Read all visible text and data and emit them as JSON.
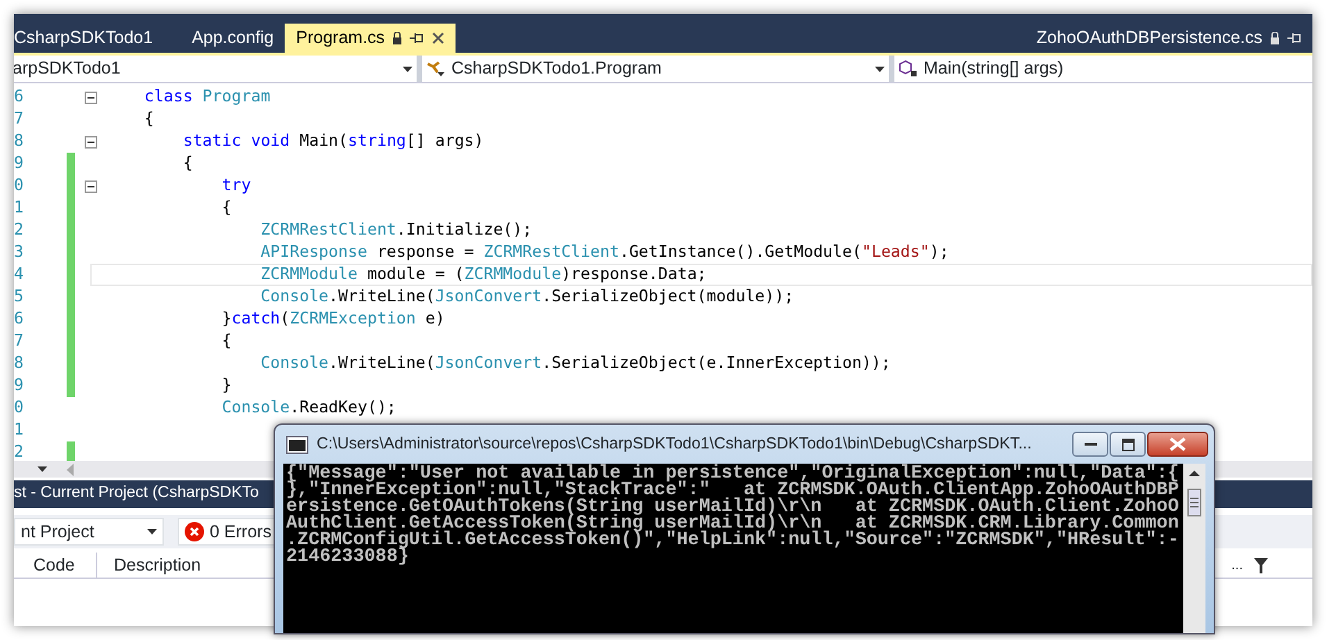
{
  "tabs": [
    {
      "label": "CsharpSDKTodo1",
      "selected": false
    },
    {
      "label": "App.config",
      "selected": false
    },
    {
      "label": "Program.cs",
      "selected": true
    },
    {
      "label": "ZohoOAuthDBPersistence.cs",
      "selected": false
    }
  ],
  "navigation_bar": {
    "project": "arpSDKTodo1",
    "class": "CsharpSDKTodo1.Program",
    "member": "Main(string[] args)"
  },
  "code_lines": [
    {
      "number": "6",
      "fold": true,
      "changed": false,
      "current": false,
      "tokens": [
        {
          "kind": "keyword",
          "text": "    class"
        },
        {
          "kind": "type",
          "text": " Program"
        }
      ]
    },
    {
      "number": "7",
      "fold": false,
      "changed": false,
      "current": false,
      "tokens": [
        {
          "kind": "plain",
          "text": "    {"
        }
      ]
    },
    {
      "number": "8",
      "fold": true,
      "changed": false,
      "current": false,
      "tokens": [
        {
          "kind": "keyword",
          "text": "        static"
        },
        {
          "kind": "keyword",
          "text": " void"
        },
        {
          "kind": "plain",
          "text": " Main("
        },
        {
          "kind": "keyword",
          "text": "string"
        },
        {
          "kind": "plain",
          "text": "[] args)"
        }
      ]
    },
    {
      "number": "9",
      "fold": false,
      "changed": true,
      "current": false,
      "tokens": [
        {
          "kind": "plain",
          "text": "        {"
        }
      ]
    },
    {
      "number": "0",
      "fold": true,
      "changed": true,
      "current": false,
      "tokens": [
        {
          "kind": "keyword",
          "text": "            try"
        }
      ]
    },
    {
      "number": "1",
      "fold": false,
      "changed": true,
      "current": false,
      "tokens": [
        {
          "kind": "plain",
          "text": "            {"
        }
      ]
    },
    {
      "number": "2",
      "fold": false,
      "changed": true,
      "current": false,
      "tokens": [
        {
          "kind": "type",
          "text": "                ZCRMRestClient"
        },
        {
          "kind": "plain",
          "text": ".Initialize();"
        }
      ]
    },
    {
      "number": "3",
      "fold": false,
      "changed": true,
      "current": false,
      "tokens": [
        {
          "kind": "type",
          "text": "                APIResponse"
        },
        {
          "kind": "plain",
          "text": " response = "
        },
        {
          "kind": "type",
          "text": "ZCRMRestClient"
        },
        {
          "kind": "plain",
          "text": ".GetInstance().GetModule("
        },
        {
          "kind": "string",
          "text": "\"Leads\""
        },
        {
          "kind": "plain",
          "text": ");"
        }
      ]
    },
    {
      "number": "4",
      "fold": false,
      "changed": true,
      "current": true,
      "tokens": [
        {
          "kind": "type",
          "text": "                ZCRMModule"
        },
        {
          "kind": "plain",
          "text": " module = ("
        },
        {
          "kind": "type",
          "text": "ZCRMModule"
        },
        {
          "kind": "plain",
          "text": ")response.Data;"
        }
      ]
    },
    {
      "number": "5",
      "fold": false,
      "changed": true,
      "current": false,
      "tokens": [
        {
          "kind": "type",
          "text": "                Console"
        },
        {
          "kind": "plain",
          "text": ".WriteLine("
        },
        {
          "kind": "type",
          "text": "JsonConvert"
        },
        {
          "kind": "plain",
          "text": ".SerializeObject(module));"
        }
      ]
    },
    {
      "number": "6",
      "fold": false,
      "changed": true,
      "current": false,
      "tokens": [
        {
          "kind": "plain",
          "text": "            }"
        },
        {
          "kind": "keyword",
          "text": "catch"
        },
        {
          "kind": "plain",
          "text": "("
        },
        {
          "kind": "type",
          "text": "ZCRMException"
        },
        {
          "kind": "plain",
          "text": " e)"
        }
      ]
    },
    {
      "number": "7",
      "fold": false,
      "changed": true,
      "current": false,
      "tokens": [
        {
          "kind": "plain",
          "text": "            {"
        }
      ]
    },
    {
      "number": "8",
      "fold": false,
      "changed": true,
      "current": false,
      "tokens": [
        {
          "kind": "type",
          "text": "                Console"
        },
        {
          "kind": "plain",
          "text": ".WriteLine("
        },
        {
          "kind": "type",
          "text": "JsonConvert"
        },
        {
          "kind": "plain",
          "text": ".SerializeObject(e.InnerException));"
        }
      ]
    },
    {
      "number": "9",
      "fold": false,
      "changed": true,
      "current": false,
      "tokens": [
        {
          "kind": "plain",
          "text": "            }"
        }
      ]
    },
    {
      "number": "0",
      "fold": false,
      "changed": false,
      "current": false,
      "tokens": [
        {
          "kind": "type",
          "text": "            Console"
        },
        {
          "kind": "plain",
          "text": ".ReadKey();"
        }
      ]
    },
    {
      "number": "1",
      "fold": false,
      "changed": false,
      "current": false
    },
    {
      "number": "2",
      "fold": false,
      "changed": true,
      "current": false
    }
  ],
  "error_list": {
    "title": "st - Current Project (CsharpSDKTo",
    "scope": "nt Project",
    "errors_button": "0 Errors",
    "columns": [
      "Code",
      "Description",
      "..."
    ]
  },
  "console": {
    "title": "C:\\Users\\Administrator\\source\\repos\\CsharpSDKTodo1\\CsharpSDKTodo1\\bin\\Debug\\CsharpSDKT...",
    "lines": [
      "{\"Message\":\"User not available in persistence\",\"OriginalException\":null,\"Data\":{",
      "},\"InnerException\":null,\"StackTrace\":\"   at ZCRMSDK.OAuth.ClientApp.ZohoOAuthDBP",
      "ersistence.GetOAuthTokens(String userMailId)\\r\\n   at ZCRMSDK.OAuth.Client.ZohoO",
      "AuthClient.GetAccessToken(String userMailId)\\r\\n   at ZCRMSDK.CRM.Library.Common",
      ".ZCRMConfigUtil.GetAccessToken()\",\"HelpLink\":null,\"Source\":\"ZCRMSDK\",\"HResult\":-",
      "2146233088}"
    ]
  }
}
